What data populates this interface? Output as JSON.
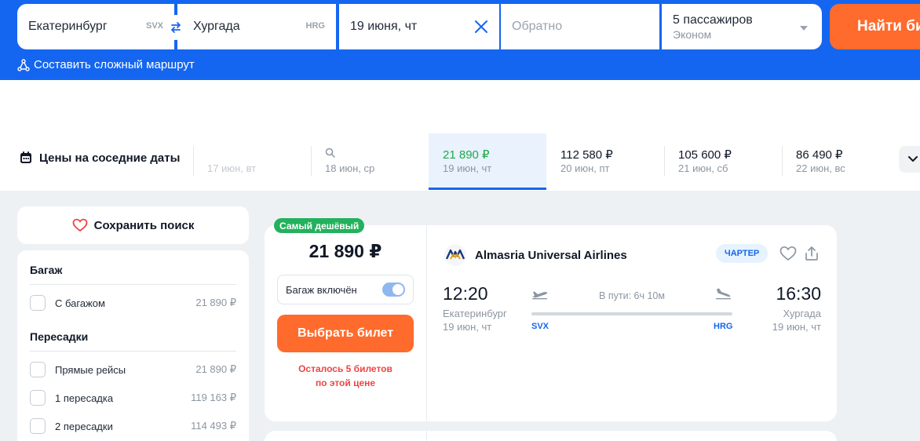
{
  "search": {
    "from": "Екатеринбург",
    "from_code": "SVX",
    "to": "Хургада",
    "to_code": "HRG",
    "date": "19 июня, чт",
    "return_placeholder": "Обратно",
    "passengers": "5 пассажиров",
    "cabin": "Эконом",
    "find_label": "Найти би",
    "complex_route": "Составить сложный маршрут"
  },
  "dates": {
    "title": "Цены на соседние даты",
    "items": [
      {
        "price": "",
        "day": "17 июн, вт"
      },
      {
        "price": "",
        "day": "18 июн, ср"
      },
      {
        "price": "21 890 ₽",
        "day": "19 июн, чт"
      },
      {
        "price": "112 580 ₽",
        "day": "20 июн, пт"
      },
      {
        "price": "105 600 ₽",
        "day": "21 июн, сб"
      },
      {
        "price": "86 490 ₽",
        "day": "22 июн, вс"
      }
    ]
  },
  "sidebar": {
    "save_search": "Сохранить поиск",
    "baggage_title": "Багаж",
    "baggage": {
      "label": "С багажом",
      "price": "21 890 ₽"
    },
    "transfers_title": "Пересадки",
    "transfers": [
      {
        "label": "Прямые рейсы",
        "price": "21 890 ₽"
      },
      {
        "label": "1 пересадка",
        "price": "119 163 ₽"
      },
      {
        "label": "2 пересадки",
        "price": "114 493 ₽"
      }
    ]
  },
  "ticket": {
    "badge": "Самый дешёвый",
    "price": "21 890 ₽",
    "baggage_included": "Багаж включён",
    "baggage_toggle_on": true,
    "choose_label": "Выбрать билет",
    "remaining_line1": "Осталось 5 билетов",
    "remaining_line2": "по этой цене",
    "airline": "Almasria Universal Airlines",
    "charter": "ЧАРТЕР",
    "departure": {
      "time": "12:20",
      "city": "Екатеринбург",
      "date": "19 июн, чт",
      "code": "SVX"
    },
    "arrival": {
      "time": "16:30",
      "city": "Хургада",
      "date": "19 июн, чт",
      "code": "HRG"
    },
    "duration": "В пути: 6ч 10м"
  },
  "colors": {
    "brand_blue": "#1466f0",
    "accent_orange": "#ff6b2c",
    "price_green": "#1ea94a",
    "badge_green": "#23b15d",
    "alert_red": "#ef4444"
  },
  "icons": {
    "swap": "swap-icon",
    "clear": "close-icon",
    "route": "route-icon",
    "calendar": "calendar-icon",
    "search": "search-icon",
    "heart": "heart-icon",
    "share": "share-icon",
    "takeoff": "plane-takeoff-icon",
    "landing": "plane-landing-icon"
  }
}
